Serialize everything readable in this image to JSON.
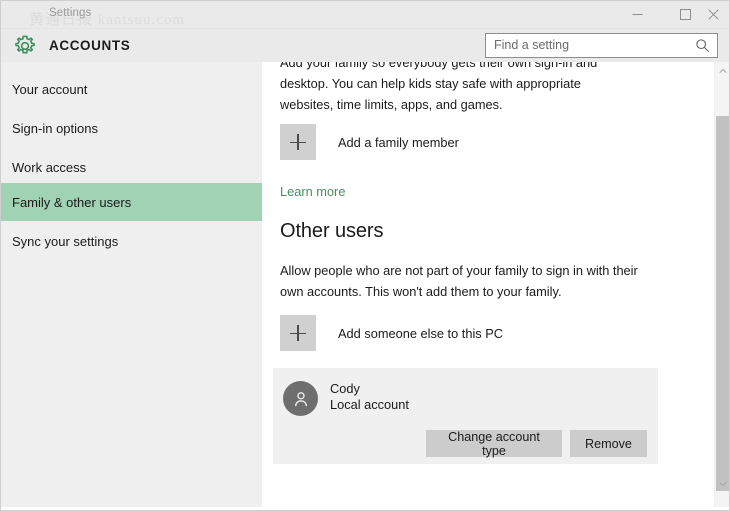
{
  "window": {
    "title": "Settings",
    "watermark": "黄通日报 kantsuu.com",
    "controls": {
      "minimize": "minimize-icon",
      "maximize": "maximize-icon",
      "close": "close-icon"
    }
  },
  "header": {
    "icon": "gear-icon",
    "title": "ACCOUNTS"
  },
  "search": {
    "placeholder": "Find a setting",
    "value": "",
    "icon": "search-icon"
  },
  "sidebar": {
    "items": [
      {
        "label": "Your account",
        "selected": false
      },
      {
        "label": "Sign-in options",
        "selected": false
      },
      {
        "label": "Work access",
        "selected": false
      },
      {
        "label": "Family & other users",
        "selected": true
      },
      {
        "label": "Sync your settings",
        "selected": false
      }
    ],
    "selected_color": "#9fd3b4",
    "background": "#efefef"
  },
  "main": {
    "family_description": "Add your family so everybody gets their own sign-in and desktop. You can help kids stay safe with appropriate websites, time limits, apps, and games.",
    "add_family_button": "Add a family member",
    "learn_more_link": "Learn more",
    "learn_more_color": "#4c8c62",
    "other_users_heading": "Other users",
    "other_users_description": "Allow people who are not part of your family to sign in with their own accounts. This won't add them to your family.",
    "add_someone_button": "Add someone else to this PC",
    "user_card": {
      "avatar": "person-icon",
      "name": "Cody",
      "account_type": "Local account",
      "buttons": {
        "change_account_type": "Change account type",
        "remove": "Remove"
      }
    }
  },
  "scrollbar": {
    "up_arrow": "chevron-up-icon",
    "down_arrow": "chevron-down-icon",
    "thumb": "scrollbar-thumb"
  }
}
